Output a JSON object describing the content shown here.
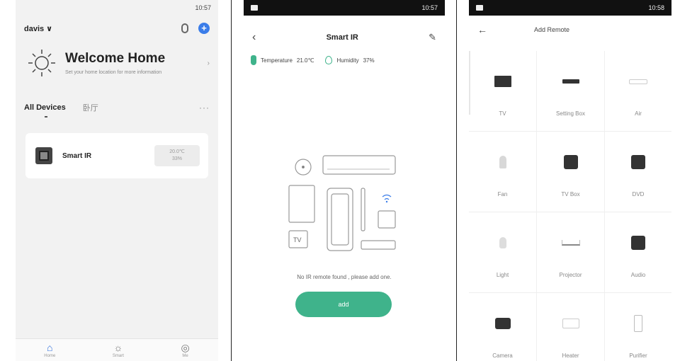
{
  "panel1": {
    "status": "10:57",
    "user": "davis ∨",
    "welcome_title": "Welcome Home",
    "welcome_sub": "Set your home location for more information",
    "tabs": [
      {
        "label": "All Devices"
      },
      {
        "label": "卧厅"
      }
    ],
    "more": "···",
    "device": {
      "name": "Smart IR",
      "readout": "20.0℃\n33%"
    },
    "nav": [
      {
        "label": "Home",
        "icon": "home-icon"
      },
      {
        "label": "Smart",
        "icon": "sun-icon"
      },
      {
        "label": "Me",
        "icon": "profile-icon"
      }
    ]
  },
  "panel2": {
    "status": "10:57",
    "title": "Smart IR",
    "temp_label": "Temperature",
    "temp_value": "21.0℃",
    "hum_label": "Humidity",
    "hum_value": "37%",
    "empty_msg": "No IR remote found , please add one.",
    "add_label": "add",
    "tv_badge": "TV",
    "accent": "#3fb38b"
  },
  "panel3": {
    "status": "10:58",
    "title": "Add Remote",
    "items": [
      {
        "label": "TV",
        "icon": "tv-icon"
      },
      {
        "label": "Setting Box",
        "icon": "set-top-box-icon"
      },
      {
        "label": "Air",
        "icon": "air-conditioner-icon"
      },
      {
        "label": "Fan",
        "icon": "fan-icon"
      },
      {
        "label": "TV Box",
        "icon": "tv-box-icon"
      },
      {
        "label": "DVD",
        "icon": "dvd-icon"
      },
      {
        "label": "Light",
        "icon": "light-icon"
      },
      {
        "label": "Projector",
        "icon": "projector-icon"
      },
      {
        "label": "Audio",
        "icon": "audio-icon"
      },
      {
        "label": "Camera",
        "icon": "camera-icon"
      },
      {
        "label": "Heater",
        "icon": "heater-icon"
      },
      {
        "label": "Purifier",
        "icon": "purifier-icon"
      }
    ]
  }
}
